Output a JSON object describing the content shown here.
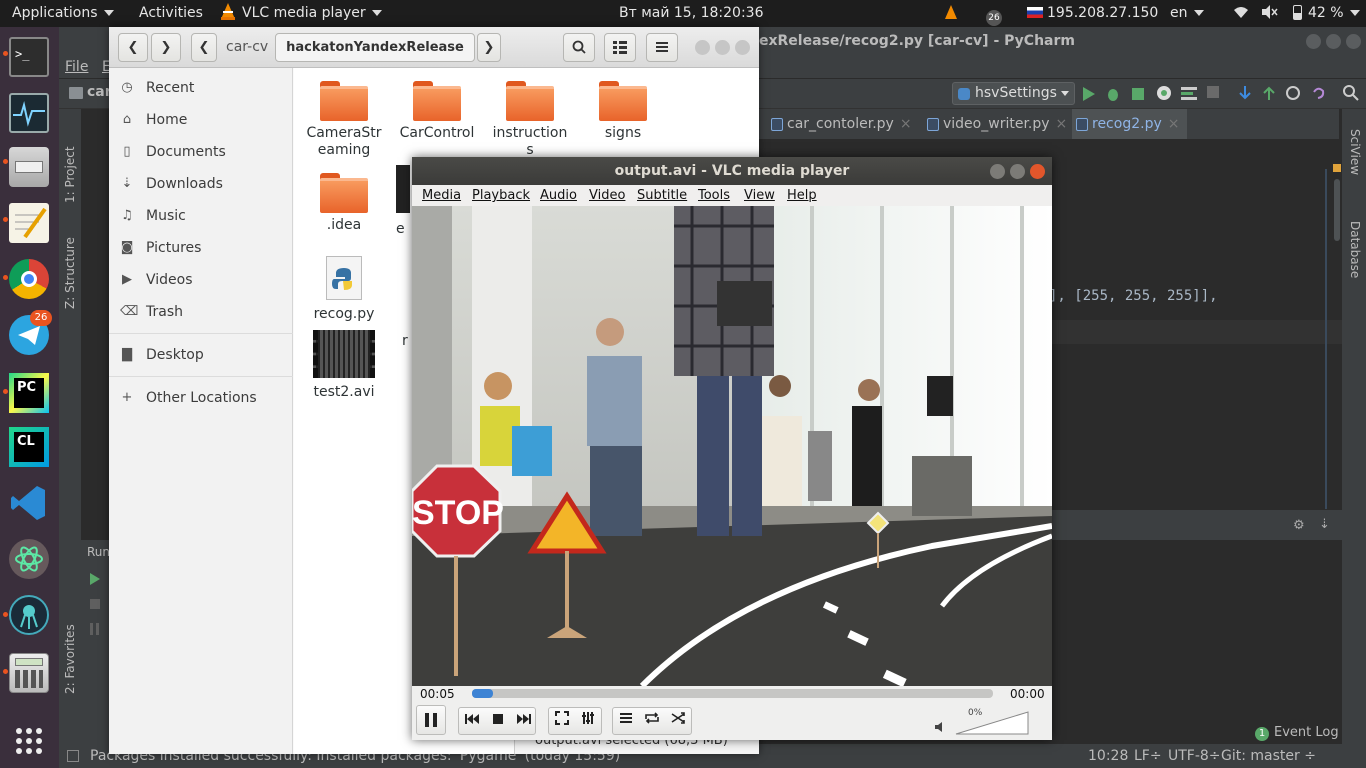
{
  "topbar": {
    "applications": "Applications",
    "activities": "Activities",
    "app_menu": "VLC media player",
    "clock": "Вт май 15, 18:20:36",
    "telegram_badge": "26",
    "ip": "195.208.27.150",
    "language": "en",
    "battery": "42 %"
  },
  "dock": {
    "telegram_badge": "26",
    "items": [
      "terminal-icon",
      "system-monitor-icon",
      "file-manager-icon",
      "text-editor-icon",
      "chrome-icon",
      "telegram-icon",
      "pycharm-icon",
      "clion-icon",
      "vscode-icon",
      "atom-icon",
      "gitkraken-icon",
      "calculator-icon",
      "show-apps-icon"
    ]
  },
  "pycharm": {
    "title": "exRelease/recog2.py [car-cv] - PyCharm",
    "menu_file": "File",
    "menu_edit": "E",
    "project_crumb": "car",
    "run_config": "hsvSettings",
    "tabs": [
      "car_contoler.py",
      "video_writer.py",
      "recog2.py"
    ],
    "code_line": "], [255, 255, 255]],",
    "left_strip": [
      "1: Project",
      "Z: Structure",
      "2: Favorites"
    ],
    "right_strip": [
      "SciView",
      "Database"
    ],
    "run_label": "Run",
    "status_message": "Packages installed successfully: Installed packages: 'Pygame' (today 15:59)",
    "position": "10:28",
    "line_sep": "LF÷",
    "encoding": "UTF-8÷",
    "git": "Git: master ÷",
    "event_log": "Event Log",
    "event_count": "1"
  },
  "nautilus": {
    "path": [
      "car-cv",
      "hackatonYandexRelease"
    ],
    "sidebar": [
      {
        "icon": "clock-icon",
        "label": "Recent"
      },
      {
        "icon": "home-icon",
        "label": "Home"
      },
      {
        "icon": "document-icon",
        "label": "Documents"
      },
      {
        "icon": "download-icon",
        "label": "Downloads"
      },
      {
        "icon": "music-icon",
        "label": "Music"
      },
      {
        "icon": "camera-icon",
        "label": "Pictures"
      },
      {
        "icon": "video-icon",
        "label": "Videos"
      },
      {
        "icon": "trash-icon",
        "label": "Trash"
      },
      {
        "icon": "folder-icon",
        "label": "Desktop"
      },
      {
        "icon": "plus-icon",
        "label": "Other Locations"
      }
    ],
    "files": [
      {
        "name": "CameraStr\neaming",
        "type": "folder"
      },
      {
        "name": "CarControl",
        "type": "folder"
      },
      {
        "name": "instruction\ns",
        "type": "folder"
      },
      {
        "name": "signs",
        "type": "folder"
      },
      {
        "name": ".idea",
        "type": "folder"
      },
      {
        "name": "e",
        "type": "video"
      },
      {
        "name": "recog.py",
        "type": "python"
      },
      {
        "name": "r",
        "type": "python"
      },
      {
        "name": "test2.avi",
        "type": "video"
      }
    ],
    "status": "output.avi  selected  (68,3 MB)"
  },
  "vlc": {
    "title": "output.avi - VLC media player",
    "menu": [
      "Media",
      "Playback",
      "Audio",
      "Video",
      "Subtitle",
      "Tools",
      "View",
      "Help"
    ],
    "time_elapsed": "00:05",
    "time_total": "00:00",
    "progress": 0.04,
    "volume": "0%",
    "stop_sign_text": "STOP"
  }
}
